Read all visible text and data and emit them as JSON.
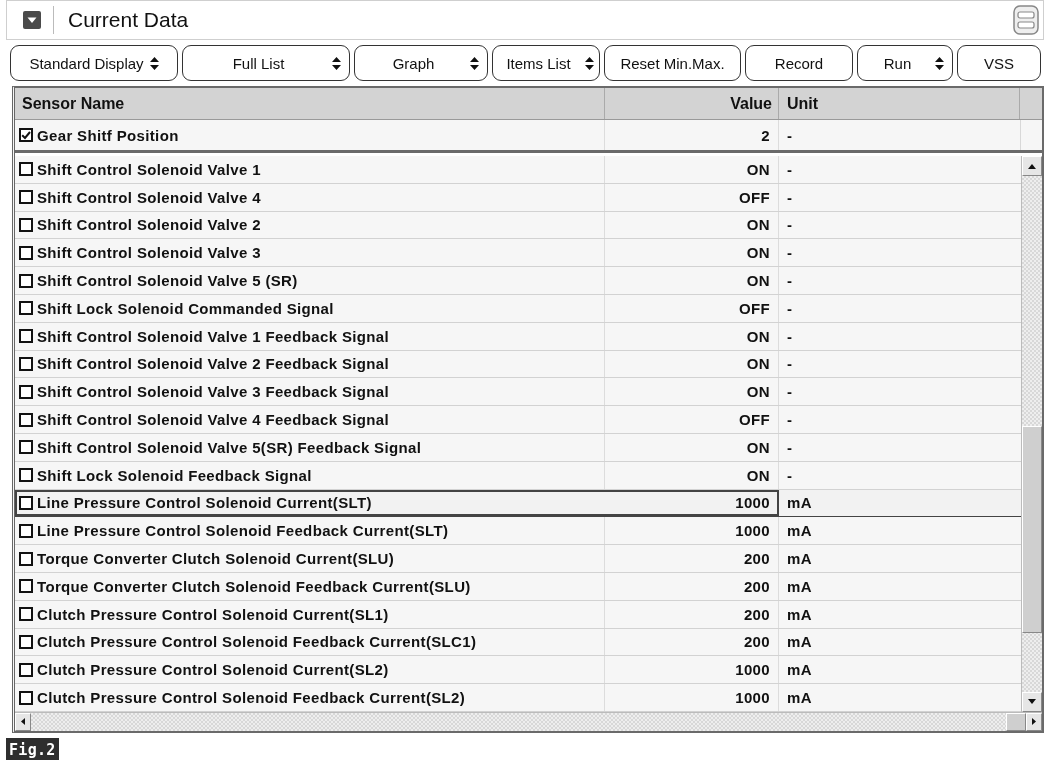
{
  "panel": {
    "title": "Current Data"
  },
  "toolbar": [
    {
      "label": "Standard Display",
      "kind": "dropdown"
    },
    {
      "label": "Full List",
      "kind": "dropdown"
    },
    {
      "label": "Graph",
      "kind": "dropdown"
    },
    {
      "label": "Items List",
      "kind": "dropdown"
    },
    {
      "label": "Reset Min.Max.",
      "kind": "button"
    },
    {
      "label": "Record",
      "kind": "button"
    },
    {
      "label": "Run",
      "kind": "dropdown"
    },
    {
      "label": "VSS",
      "kind": "button"
    }
  ],
  "table": {
    "columns": [
      "Sensor Name",
      "Value",
      "Unit"
    ],
    "pinned_rows": [
      {
        "name": "Gear Shitf Position",
        "value": "2",
        "unit": "-",
        "checked": true,
        "selected": false
      }
    ],
    "rows": [
      {
        "name": "Shift Control Solenoid Valve 1",
        "value": "ON",
        "unit": "-",
        "checked": false,
        "selected": false
      },
      {
        "name": "Shift Control Solenoid Valve 4",
        "value": "OFF",
        "unit": "-",
        "checked": false,
        "selected": false
      },
      {
        "name": "Shift Control Solenoid Valve 2",
        "value": "ON",
        "unit": "-",
        "checked": false,
        "selected": false
      },
      {
        "name": "Shift Control Solenoid Valve 3",
        "value": "ON",
        "unit": "-",
        "checked": false,
        "selected": false
      },
      {
        "name": "Shift Control Solenoid Valve 5 (SR)",
        "value": "ON",
        "unit": "-",
        "checked": false,
        "selected": false
      },
      {
        "name": "Shift Lock Solenoid Commanded Signal",
        "value": "OFF",
        "unit": "-",
        "checked": false,
        "selected": false
      },
      {
        "name": "Shift Control Solenoid Valve 1 Feedback Signal",
        "value": "ON",
        "unit": "-",
        "checked": false,
        "selected": false
      },
      {
        "name": "Shift Control Solenoid Valve 2 Feedback Signal",
        "value": "ON",
        "unit": "-",
        "checked": false,
        "selected": false
      },
      {
        "name": "Shift Control Solenoid Valve 3 Feedback Signal",
        "value": "ON",
        "unit": "-",
        "checked": false,
        "selected": false
      },
      {
        "name": "Shift Control Solenoid Valve 4 Feedback Signal",
        "value": "OFF",
        "unit": "-",
        "checked": false,
        "selected": false
      },
      {
        "name": "Shift Control Solenoid Valve 5(SR) Feedback Signal",
        "value": "ON",
        "unit": "-",
        "checked": false,
        "selected": false
      },
      {
        "name": "Shift Lock Solenoid Feedback Signal",
        "value": "ON",
        "unit": "-",
        "checked": false,
        "selected": false
      },
      {
        "name": "Line Pressure Control Solenoid Current(SLT)",
        "value": "1000",
        "unit": "mA",
        "checked": false,
        "selected": true
      },
      {
        "name": "Line Pressure Control Solenoid Feedback Current(SLT)",
        "value": "1000",
        "unit": "mA",
        "checked": false,
        "selected": false
      },
      {
        "name": "Torque Converter Clutch Solenoid Current(SLU)",
        "value": "200",
        "unit": "mA",
        "checked": false,
        "selected": false
      },
      {
        "name": "Torque Converter Clutch Solenoid Feedback Current(SLU)",
        "value": "200",
        "unit": "mA",
        "checked": false,
        "selected": false
      },
      {
        "name": "Clutch Pressure Control Solenoid Current(SL1)",
        "value": "200",
        "unit": "mA",
        "checked": false,
        "selected": false
      },
      {
        "name": "Clutch Pressure Control Solenoid Feedback Current(SLC1)",
        "value": "200",
        "unit": "mA",
        "checked": false,
        "selected": false
      },
      {
        "name": "Clutch Pressure Control Solenoid Current(SL2)",
        "value": "1000",
        "unit": "mA",
        "checked": false,
        "selected": false
      },
      {
        "name": "Clutch Pressure Control Solenoid Feedback Current(SL2)",
        "value": "1000",
        "unit": "mA",
        "checked": false,
        "selected": false
      }
    ]
  },
  "caption": "Fig.2"
}
